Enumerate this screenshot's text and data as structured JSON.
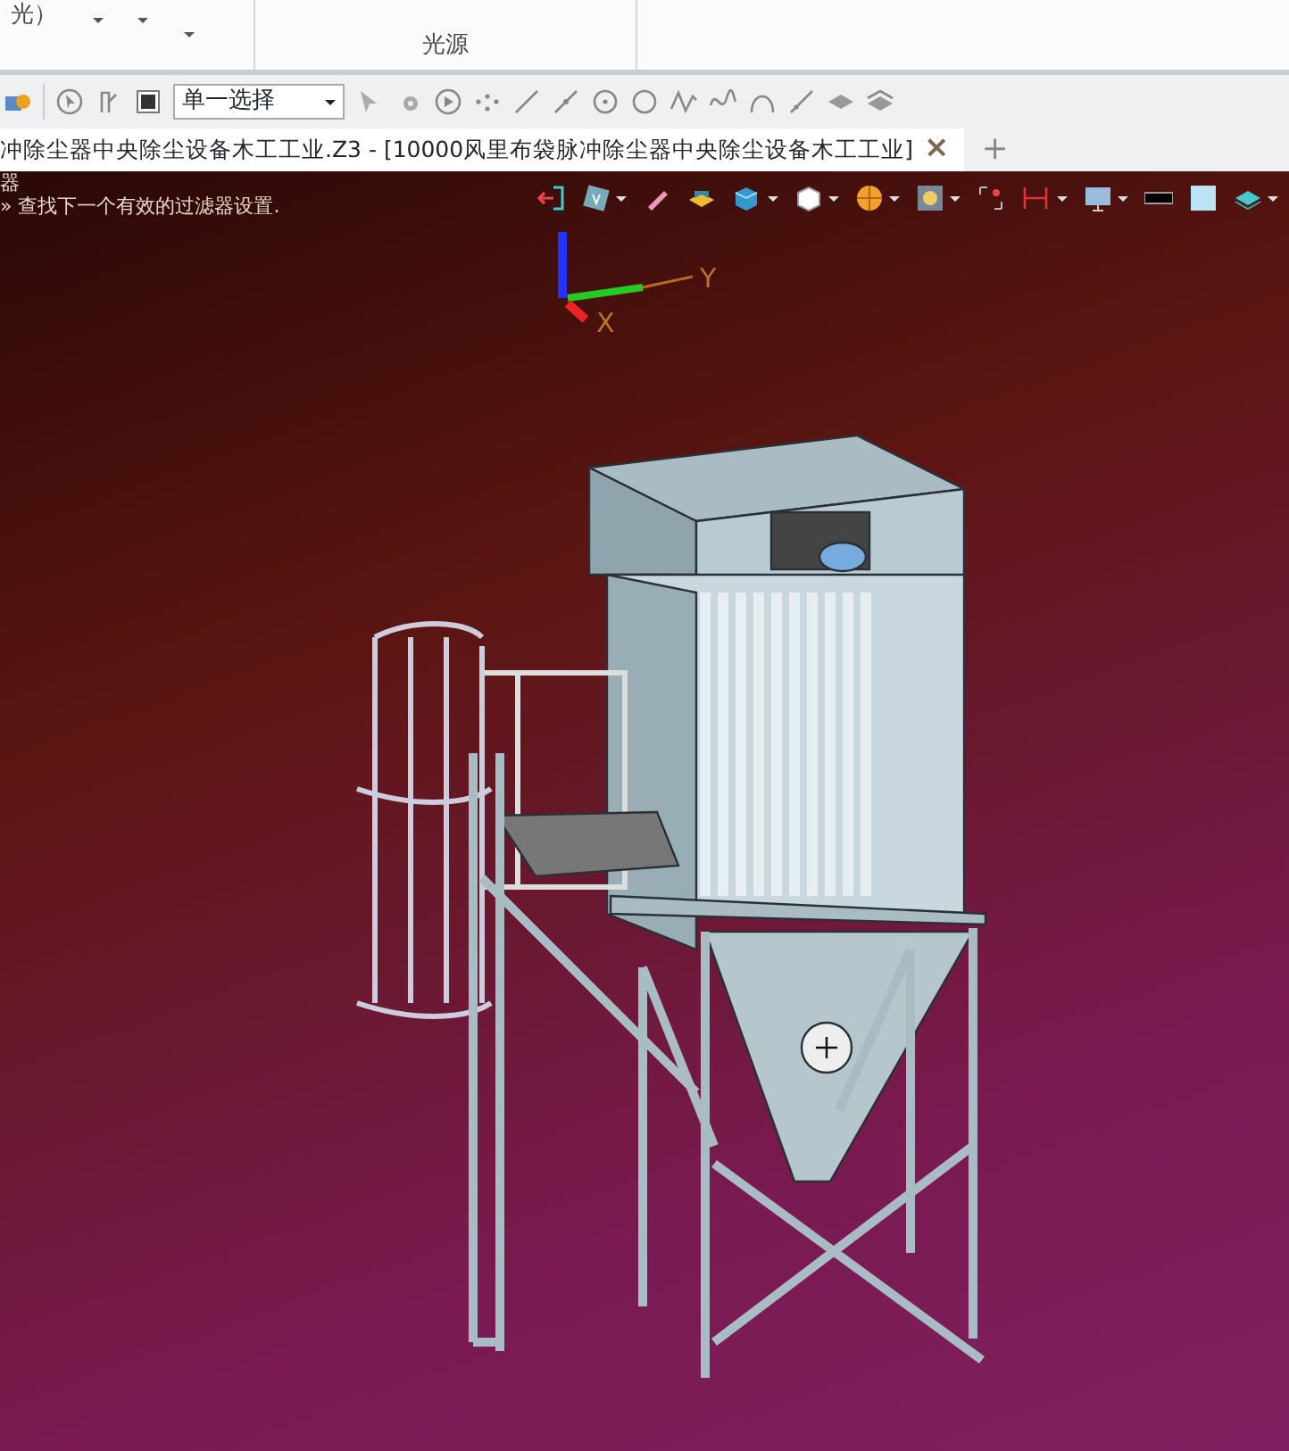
{
  "ribbon": {
    "cut_label": "光）",
    "group_title": "光源"
  },
  "toolbar": {
    "select_mode": {
      "value": "单一选择"
    }
  },
  "tabs": [
    {
      "label": "冲除尘器中央除尘设备木工工业.Z3 - [10000风里布袋脉冲除尘器中央除尘设备木工工业]",
      "selected": true,
      "close": "×"
    }
  ],
  "new_tab": "+",
  "viewport": {
    "messages": [
      "器",
      "» 查找下一个有效的过滤器设置."
    ],
    "axes": {
      "y": "Y",
      "x": "X"
    }
  }
}
